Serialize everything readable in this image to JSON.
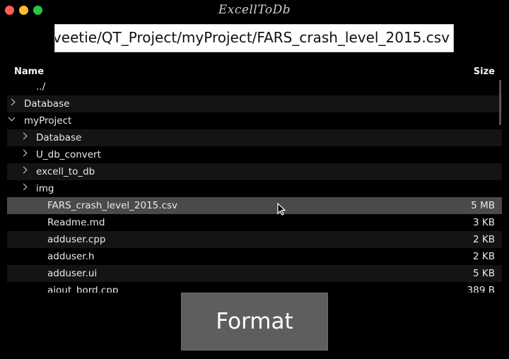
{
  "window": {
    "title": "ExcellToDb"
  },
  "path_field": {
    "value": "veetie/QT_Project/myProject/FARS_crash_level_2015.csv"
  },
  "table": {
    "columns": {
      "name": "Name",
      "size": "Size"
    },
    "rows": [
      {
        "name": "../",
        "size": "",
        "depth": 1,
        "expander": "none",
        "selected": false
      },
      {
        "name": "Database",
        "size": "",
        "depth": 0,
        "expander": "collapsed",
        "selected": false
      },
      {
        "name": "myProject",
        "size": "",
        "depth": 0,
        "expander": "expanded",
        "selected": false
      },
      {
        "name": "Database",
        "size": "",
        "depth": 1,
        "expander": "collapsed",
        "selected": false
      },
      {
        "name": "U_db_convert",
        "size": "",
        "depth": 1,
        "expander": "collapsed",
        "selected": false
      },
      {
        "name": "excell_to_db",
        "size": "",
        "depth": 1,
        "expander": "collapsed",
        "selected": false
      },
      {
        "name": "img",
        "size": "",
        "depth": 1,
        "expander": "collapsed",
        "selected": false
      },
      {
        "name": "FARS_crash_level_2015.csv",
        "size": "5 MB",
        "depth": 2,
        "expander": "none",
        "selected": true
      },
      {
        "name": "Readme.md",
        "size": "3 KB",
        "depth": 2,
        "expander": "none",
        "selected": false
      },
      {
        "name": "adduser.cpp",
        "size": "2 KB",
        "depth": 2,
        "expander": "none",
        "selected": false
      },
      {
        "name": "adduser.h",
        "size": "2 KB",
        "depth": 2,
        "expander": "none",
        "selected": false
      },
      {
        "name": "adduser.ui",
        "size": "5 KB",
        "depth": 2,
        "expander": "none",
        "selected": false
      },
      {
        "name": "ajout_bord.cpp",
        "size": "389 B",
        "depth": 2,
        "expander": "none",
        "selected": false
      }
    ]
  },
  "format_button": {
    "label": "Format"
  },
  "colors": {
    "background": "#000000",
    "selected_row": "#4a4a4a",
    "button": "#5e5e5e",
    "close": "#fe5f57",
    "minimize": "#febc2e",
    "maximize": "#28c840"
  },
  "icons": [
    "close-icon",
    "minimize-icon",
    "maximize-icon",
    "chevron-right-icon",
    "chevron-down-icon",
    "mouse-cursor-icon"
  ]
}
